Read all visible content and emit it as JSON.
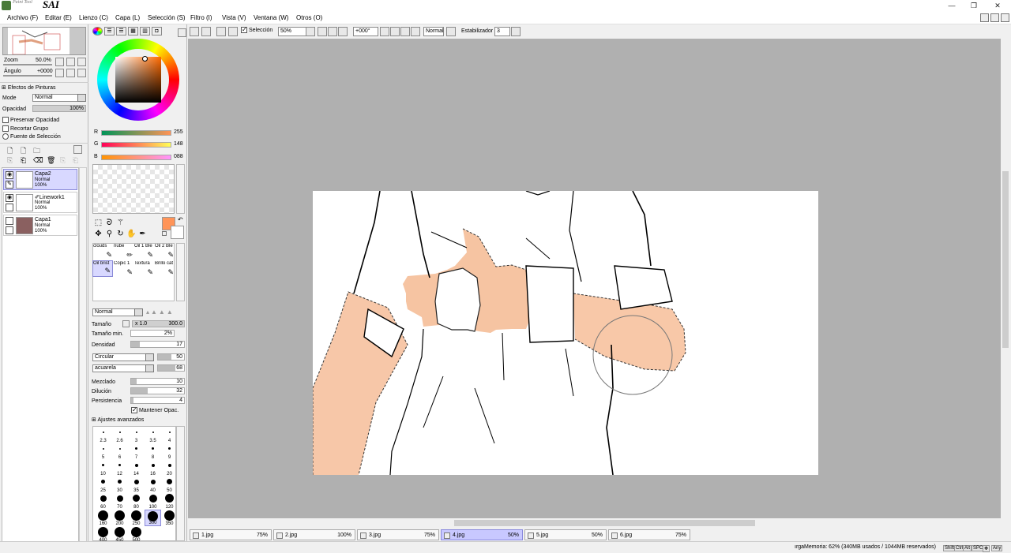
{
  "app": {
    "logo_small": "Paint Tool",
    "logo_main": "SAI"
  },
  "window": {
    "minimize": "—",
    "restore": "❐",
    "close": "✕"
  },
  "menu": [
    "Archivo (F)",
    "Editar (E)",
    "Lienzo (C)",
    "Capa (L)",
    "Selección (S)",
    "Filtro (I)",
    "Vista (V)",
    "Ventana (W)",
    "Otros (O)"
  ],
  "toolbar": {
    "selection_label": "Selección",
    "zoom": "50%",
    "rotation": "+000°",
    "blend": "Normal",
    "stabilizer_label": "Estabilizador",
    "stabilizer": "3"
  },
  "navigator": {
    "zoom_label": "Zoom",
    "zoom": "50.0%",
    "angle_label": "Ángulo",
    "angle": "+0000"
  },
  "layer_panel": {
    "effects": "Efectos de Pinturas",
    "mode_label": "Mode",
    "mode": "Normal",
    "opacity_label": "Opacidad",
    "opacity": "100%",
    "preserve": "Preservar Opacidad",
    "clip": "Recortar Grupo",
    "selection_source": "Fuente de Selección",
    "layers": [
      {
        "name": "Capa2",
        "mode": "Normal",
        "opacity": "100%"
      },
      {
        "name": "Linework1",
        "mode": "Normal",
        "opacity": "100%"
      },
      {
        "name": "Capa1",
        "mode": "Normal",
        "opacity": "100%"
      }
    ]
  },
  "color": {
    "r_label": "R",
    "r": "255",
    "g_label": "G",
    "g": "148",
    "b_label": "B",
    "b": "088",
    "primary": "#ff9458",
    "wheel_hue": "#ff6a00"
  },
  "brushes": [
    {
      "name": "clouds"
    },
    {
      "name": "nube"
    },
    {
      "name": "Oil 1 Ble"
    },
    {
      "name": "Oil 2 Ble"
    },
    {
      "name": "Oil brist"
    },
    {
      "name": "Copic 1"
    },
    {
      "name": "Textura"
    },
    {
      "name": "Brillo cat"
    }
  ],
  "brush_props": {
    "blend": "Normal",
    "size_label": "Tamaño",
    "size_mult": "x 1.0",
    "size": "300.0",
    "min_size_label": "Tamaño min.",
    "min_size": "2%",
    "density_label": "Densidad",
    "density": "17",
    "shape": "Circular",
    "shape_val": "50",
    "texture": "acuarela",
    "texture_val": "68",
    "blend2_label": "Mezclado",
    "blend2": "10",
    "dilution_label": "Dilución",
    "dilution": "32",
    "persist_label": "Persistencia",
    "persist": "4",
    "keep_opacity": "Mantener Opac.",
    "advanced": "Ajustes avanzados"
  },
  "brush_sizes": [
    "2.3",
    "2.6",
    "3",
    "3.5",
    "4",
    "5",
    "6",
    "7",
    "8",
    "9",
    "10",
    "12",
    "14",
    "16",
    "20",
    "25",
    "30",
    "35",
    "40",
    "50",
    "60",
    "70",
    "80",
    "100",
    "120",
    "160",
    "200",
    "250",
    "300",
    "350",
    "400",
    "450",
    "500"
  ],
  "files": [
    {
      "name": "1.jpg",
      "zoom": "75%"
    },
    {
      "name": "2.jpg",
      "zoom": "100%"
    },
    {
      "name": "3.jpg",
      "zoom": "75%"
    },
    {
      "name": "4.jpg",
      "zoom": "50%"
    },
    {
      "name": "5.jpg",
      "zoom": "50%"
    },
    {
      "name": "6.jpg",
      "zoom": "75%"
    }
  ],
  "status": {
    "memory": "ırgaMemoria: 62% (340MB usados / 1044MB reservados)",
    "keys": [
      "Shift",
      "Ctrl",
      "Alt",
      "SPC",
      "✥",
      "Any"
    ]
  }
}
